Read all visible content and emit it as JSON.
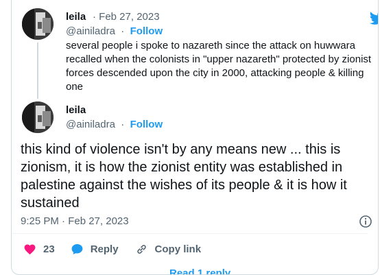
{
  "parent": {
    "name": "leila",
    "date": "· Feb 27, 2023",
    "handle": "@ainiladra",
    "separator": "·",
    "follow_label": "Follow",
    "text": "several people i spoke to nazareth since the attack on huwwara recalled when the colonists in \"upper nazareth\" protected by zionist forces descended upon the city in 2000, attacking people & killing one"
  },
  "main": {
    "name": "leila",
    "handle": "@ainiladra",
    "separator": "·",
    "follow_label": "Follow",
    "text": "this kind of violence isn't by any means new ... this is zionism, it is how the zionist entity was established in palestine against the wishes of its people & it is how it sustained",
    "timestamp": "9:25 PM · Feb 27, 2023"
  },
  "actions": {
    "like_count": "23",
    "reply_label": "Reply",
    "copy_label": "Copy link"
  },
  "footer": {
    "read_replies_label": "Read 1 reply"
  },
  "colors": {
    "accent": "#1d9bf0",
    "like": "#f91880",
    "text": "#0f1419",
    "muted": "#536471"
  },
  "icons": [
    "twitter-bird-icon",
    "info-icon",
    "heart-icon",
    "reply-bubble-icon",
    "link-icon"
  ]
}
